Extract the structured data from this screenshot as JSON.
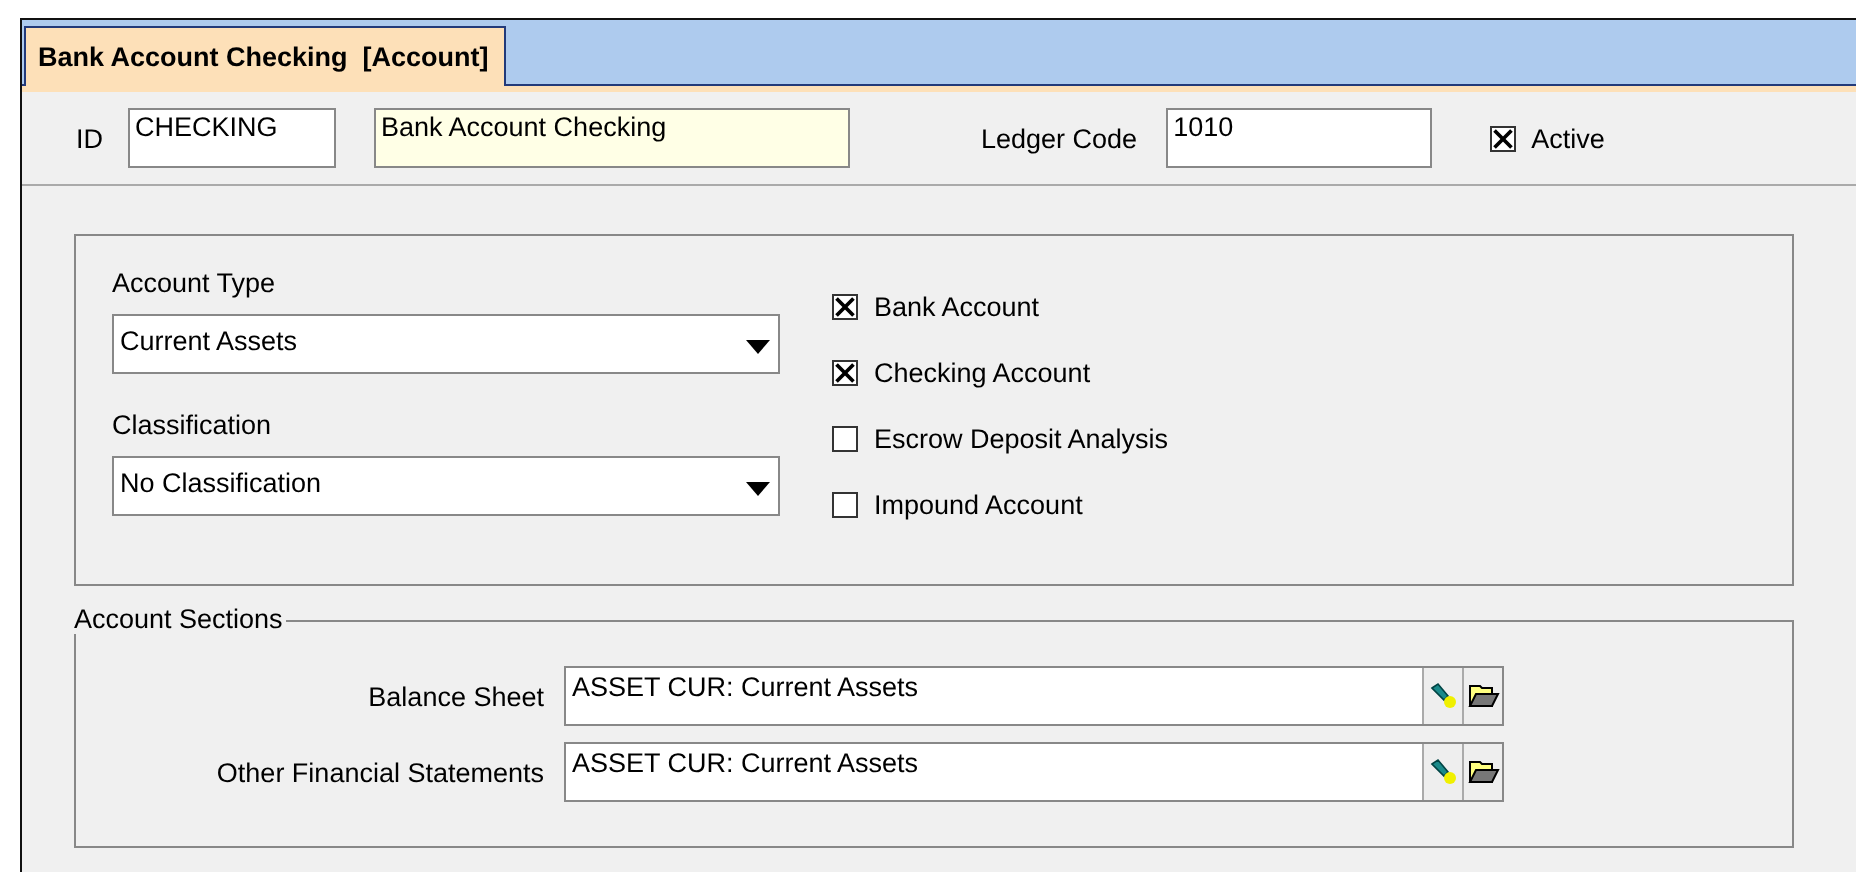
{
  "tab": {
    "label": "Bank Account Checking  [Account]",
    "selected": true
  },
  "header": {
    "id_label": "ID",
    "id_value": "CHECKING",
    "name_value": "Bank Account Checking",
    "ledger_label": "Ledger Code",
    "ledger_value": "1010",
    "active": {
      "label": "Active",
      "checked": true
    }
  },
  "account_type": {
    "label": "Account Type",
    "value": "Current Assets"
  },
  "classification": {
    "label": "Classification",
    "value": "No Classification"
  },
  "options": [
    {
      "label": "Bank Account",
      "checked": true
    },
    {
      "label": "Checking Account",
      "checked": true
    },
    {
      "label": "Escrow Deposit Analysis",
      "checked": false
    },
    {
      "label": "Impound Account",
      "checked": false
    }
  ],
  "account_sections": {
    "title": "Account Sections",
    "rows": [
      {
        "label": "Balance Sheet",
        "value": "ASSET CUR: Current Assets"
      },
      {
        "label": "Other Financial Statements",
        "value": "ASSET CUR: Current Assets"
      }
    ]
  }
}
